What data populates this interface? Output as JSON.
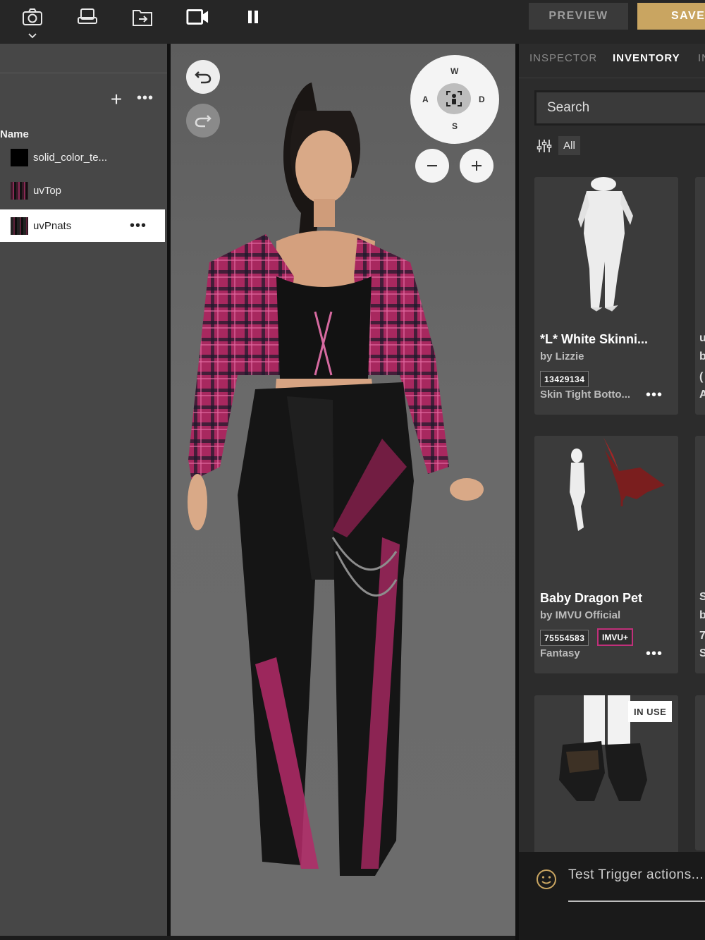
{
  "toolbar": {
    "icons": [
      "camera-icon",
      "chevron-down-icon",
      "device-icon",
      "export-folder-icon",
      "video-camera-icon",
      "pause-icon"
    ],
    "preview_label": "PREVIEW",
    "save_label": "SAVE",
    "accent": "#c9a561"
  },
  "left_panel": {
    "add_icon": "plus-icon",
    "more_icon": "ellipsis-icon",
    "column_header": "Name",
    "layers": [
      {
        "name": "solid_color_te..."
      },
      {
        "name": "uvTop"
      },
      {
        "name": "uvPnats",
        "selected": true
      }
    ]
  },
  "viewport": {
    "undo_icon": "undo-icon",
    "redo_icon": "redo-icon",
    "compass": {
      "north": "W",
      "west": "A",
      "east": "D",
      "south": "S"
    },
    "zoom_out_icon": "minus-icon",
    "zoom_in_icon": "plus-icon"
  },
  "right_panel": {
    "tabs": [
      "INSPECTOR",
      "INVENTORY",
      "IN"
    ],
    "active_tab": "INVENTORY",
    "search_placeholder": "Search",
    "filter_chip": "All",
    "items": [
      {
        "title": "*L* White Skinni...",
        "by": "by Lizzie",
        "product_id": "13429134",
        "category": "Skin Tight Botto..."
      },
      {
        "title": "Baby Dragon Pet",
        "by": "by IMVU Official",
        "product_id": "75554583",
        "badge": "IMVU+",
        "category": "Fantasy"
      },
      {
        "title": "",
        "in_use": "IN USE"
      }
    ],
    "peek_letters": [
      "u",
      "b",
      "(",
      "A",
      "S",
      "b",
      "7",
      "S"
    ],
    "trigger_placeholder": "Test Trigger actions..."
  }
}
